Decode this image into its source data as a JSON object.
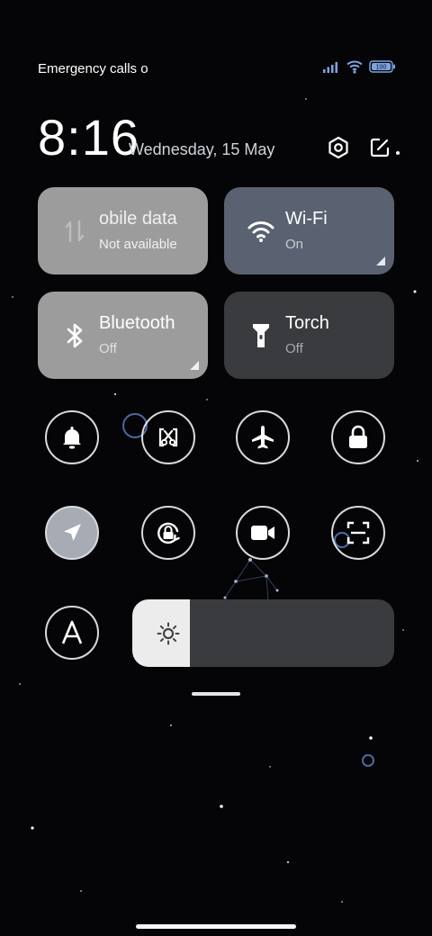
{
  "status_bar": {
    "carrier": "Emergency calls o",
    "battery": "100",
    "icons": [
      "signal-icon",
      "wifi-icon",
      "battery-icon"
    ]
  },
  "header": {
    "time": "8:16",
    "date": "Wednesday, 15 May",
    "settings_icon": "gear-icon",
    "edit_icon": "edit-icon"
  },
  "tiles": [
    {
      "title": "obile data",
      "subtitle": "Not available",
      "icon": "mobile-data-icon",
      "state": "unavailable"
    },
    {
      "title": "Wi-Fi",
      "subtitle": "On",
      "icon": "wifi-icon",
      "state": "on"
    },
    {
      "title": "Bluetooth",
      "subtitle": "Off",
      "icon": "bluetooth-icon",
      "state": "off"
    },
    {
      "title": "Torch",
      "subtitle": "Off",
      "icon": "torch-icon",
      "state": "off"
    }
  ],
  "toggles_row1": [
    "bell-icon",
    "screenshot-icon",
    "airplane-icon",
    "lock-icon"
  ],
  "toggles_row2": [
    "location-icon",
    "rotation-lock-icon",
    "video-record-icon",
    "scan-icon"
  ],
  "auto_brightness_icon": "auto-brightness-icon",
  "brightness": {
    "level": 0.22,
    "icon": "sun-icon"
  },
  "colors": {
    "tile_gray": "#9c9c9c",
    "tile_wifi": "#5a6170",
    "tile_dark": "#3a3b3e",
    "active_round": "#a7abb3",
    "background": "#050507"
  }
}
